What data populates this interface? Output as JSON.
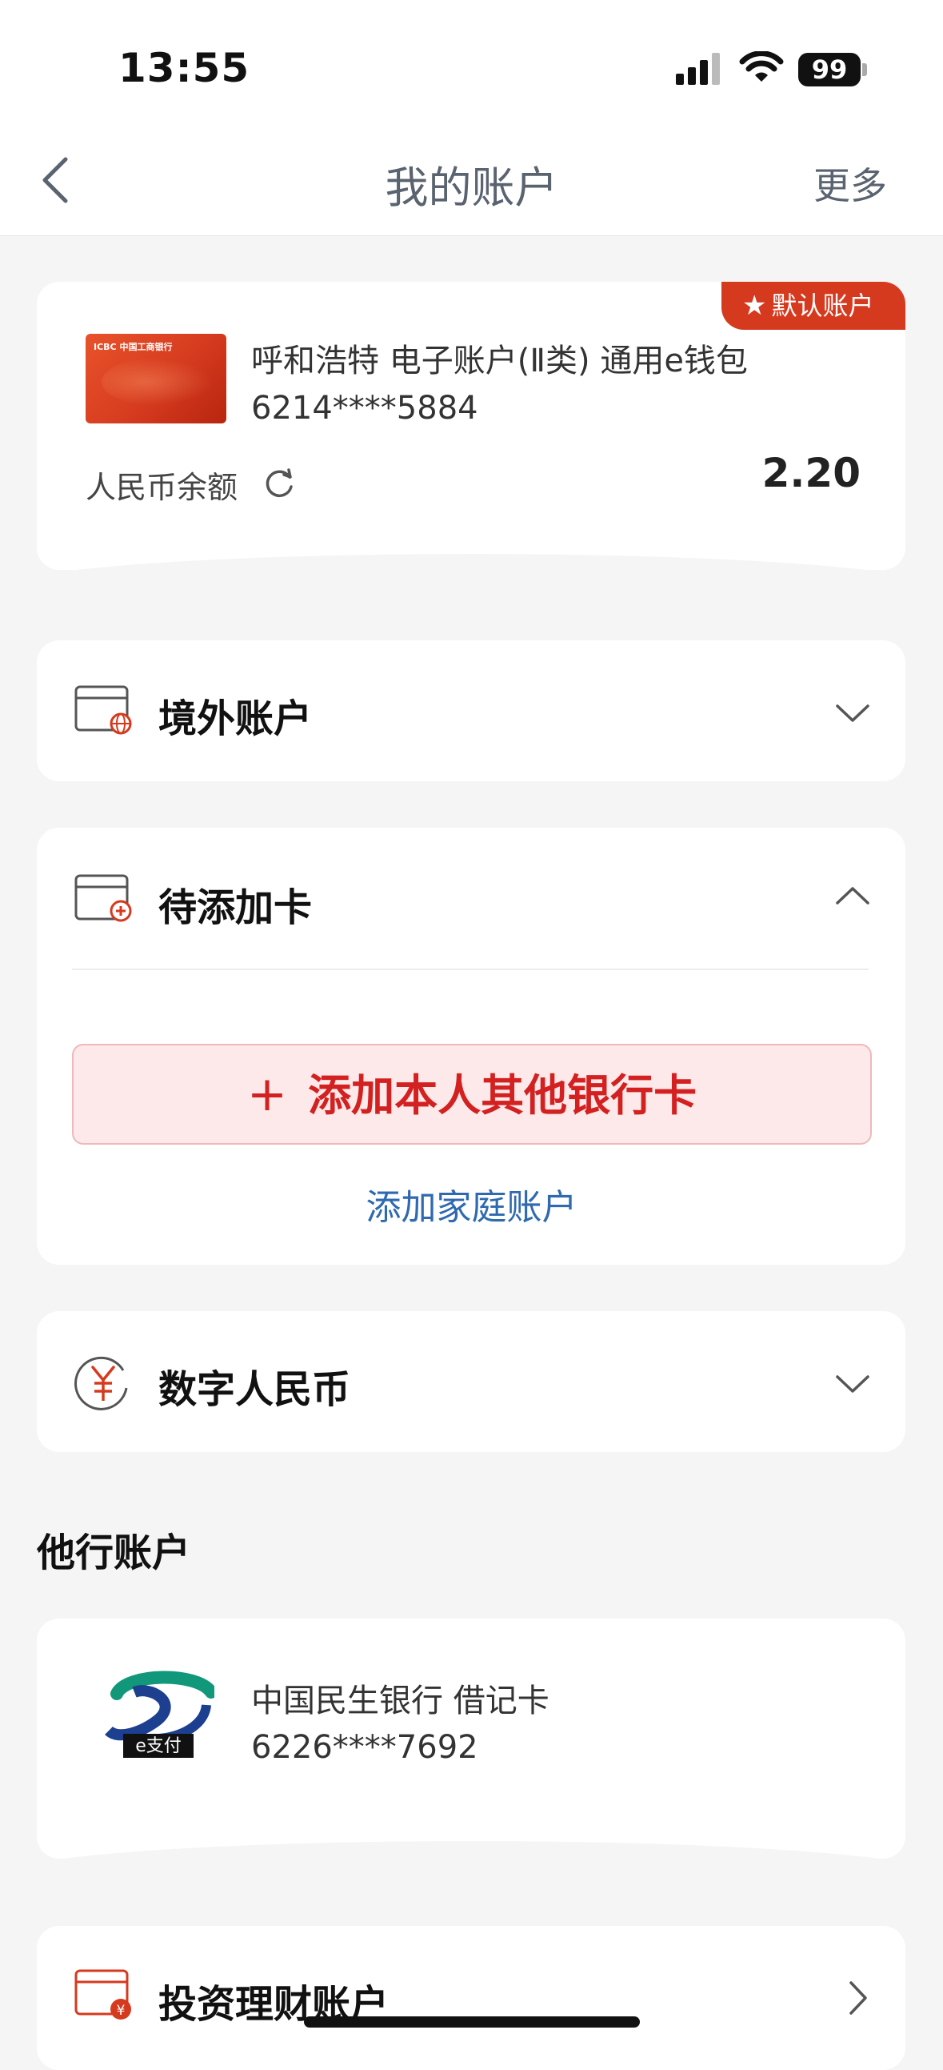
{
  "status_bar": {
    "time": "13:55",
    "battery": "99"
  },
  "header": {
    "title": "我的账户",
    "more_label": "更多"
  },
  "primary_account": {
    "badge": "默认账户",
    "name": "呼和浩特 电子账户(Ⅱ类) 通用e钱包",
    "number": "6214****5884",
    "balance_label": "人民币余额",
    "balance": "2.20",
    "card_logo_text": "ICBC 中国工商银行"
  },
  "sections": {
    "overseas": {
      "label": "境外账户"
    },
    "pending": {
      "label": "待添加卡",
      "add_card_label": "添加本人其他银行卡",
      "add_family_label": "添加家庭账户"
    },
    "ecny": {
      "label": "数字人民币"
    }
  },
  "other_accounts": {
    "title": "他行账户",
    "items": [
      {
        "name": "中国民生银行 借记卡",
        "number": "6226****7692",
        "logo_text": "e支付"
      }
    ]
  },
  "invest": {
    "label": "投资理财账户"
  },
  "colors": {
    "accent_red": "#d63a1e",
    "link_blue": "#2f6ab0"
  }
}
